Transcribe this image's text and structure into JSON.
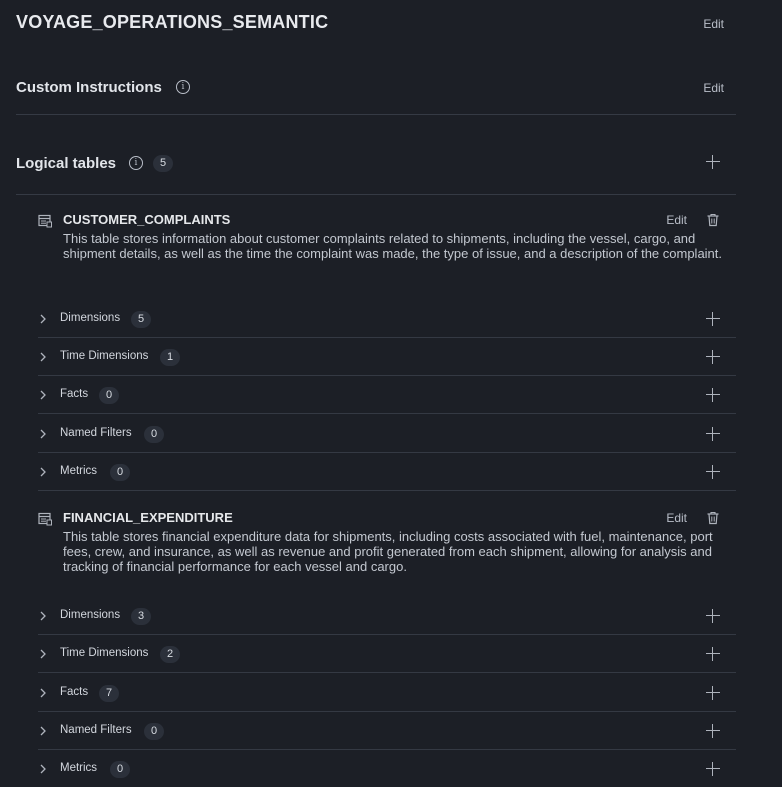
{
  "header": {
    "title": "VOYAGE_OPERATIONS_SEMANTIC",
    "edit_label": "Edit"
  },
  "custom_instructions": {
    "title": "Custom Instructions",
    "info_glyph": "i",
    "edit_label": "Edit"
  },
  "logical_tables": {
    "title": "Logical tables",
    "info_glyph": "i",
    "count": "5",
    "tables": [
      {
        "name": "CUSTOMER_COMPLAINTS",
        "edit_label": "Edit",
        "description": "This table stores information about customer complaints related to shipments, including the vessel, cargo, and shipment details, as well as the time the complaint was made, the type of issue, and a description of the complaint.",
        "categories": [
          {
            "label": "Dimensions",
            "count": "5"
          },
          {
            "label": "Time Dimensions",
            "count": "1"
          },
          {
            "label": "Facts",
            "count": "0"
          },
          {
            "label": "Named Filters",
            "count": "0"
          },
          {
            "label": "Metrics",
            "count": "0"
          }
        ]
      },
      {
        "name": "FINANCIAL_EXPENDITURE",
        "edit_label": "Edit",
        "description": "This table stores financial expenditure data for shipments, including costs associated with fuel, maintenance, port fees, crew, and insurance, as well as revenue and profit generated from each shipment, allowing for analysis and tracking of financial performance for each vessel and cargo.",
        "categories": [
          {
            "label": "Dimensions",
            "count": "3"
          },
          {
            "label": "Time Dimensions",
            "count": "2"
          },
          {
            "label": "Facts",
            "count": "7"
          },
          {
            "label": "Named Filters",
            "count": "0"
          },
          {
            "label": "Metrics",
            "count": "0"
          }
        ]
      }
    ]
  },
  "icons": {
    "info": "info-icon",
    "add": "plus-icon",
    "expand": "chevron-right-icon",
    "table": "table-icon",
    "delete": "trash-icon"
  },
  "colors": {
    "background": "#1c1f26",
    "divider": "#353a44",
    "badge_bg": "#2b303a",
    "text_primary": "#e6e8eb",
    "text_secondary": "#c3c8d0"
  }
}
